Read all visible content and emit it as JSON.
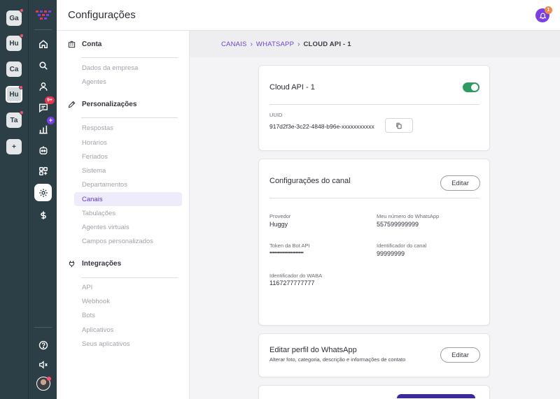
{
  "workspaces": [
    {
      "label": "Ga",
      "active": false,
      "dot": true
    },
    {
      "label": "Hu",
      "active": false,
      "dot": true
    },
    {
      "label": "Ca",
      "active": false,
      "dot": false
    },
    {
      "label": "Hu",
      "active": true,
      "dot": true
    },
    {
      "label": "Ta",
      "active": false,
      "dot": true
    },
    {
      "label": "+",
      "active": false,
      "dot": false
    }
  ],
  "nav": {
    "chat_badge": "9+",
    "reports_badge": "+",
    "icons": [
      "home-icon",
      "search-icon",
      "contact-icon",
      "chat-icon",
      "reports-icon",
      "bot-icon",
      "apps-icon",
      "settings-icon",
      "billing-icon",
      "help-icon",
      "mute-icon"
    ]
  },
  "header": {
    "title": "Configurações",
    "notification_count": "1"
  },
  "menu": {
    "account": {
      "title": "Conta",
      "items": [
        "Dados da empresa",
        "Agentes"
      ]
    },
    "custom": {
      "title": "Personalizações",
      "items": [
        "Respostas",
        "Horários",
        "Feriados",
        "Sistema",
        "Departamentos",
        "Canais",
        "Tabulações",
        "Agentes virtuais",
        "Campos personalizados"
      ],
      "active": "Canais"
    },
    "integrations": {
      "title": "Integrações",
      "items": [
        "API",
        "Webhook",
        "Bots",
        "Aplicativos",
        "Seus aplicativos"
      ]
    }
  },
  "breadcrumb": [
    "CANAIS",
    "WHATSAPP",
    "CLOUD API - 1"
  ],
  "channel_card": {
    "title": "Cloud API - 1",
    "enabled": true,
    "uuid_label": "UUID",
    "uuid_value": "917d2f3e-3c22-4848-b96e-xxxxxxxxxxx"
  },
  "config_card": {
    "title": "Configurações do canal",
    "edit_label": "Editar",
    "fields": {
      "provider_label": "Provedor",
      "provider_value": "Huggy",
      "number_label": "Meu número do WhatsApp",
      "number_value": "557599999999",
      "token_label": "Token da Bot API",
      "token_value": "•••••••••••••••••••••",
      "channel_id_label": "Identificador do canal",
      "channel_id_value": "99999999",
      "waba_label": "Identificador do WABA",
      "waba_value": "1167277777777"
    }
  },
  "profile_card": {
    "title": "Editar perfil do WhatsApp",
    "subtitle": "Alterar foto, categoria, descrição e informações de contato",
    "edit_label": "Editar"
  },
  "colors": {
    "rail": "#2c3e46",
    "accent": "#7b3fe4",
    "toggle_on": "#2e9b63",
    "badge": "#e8344e"
  }
}
